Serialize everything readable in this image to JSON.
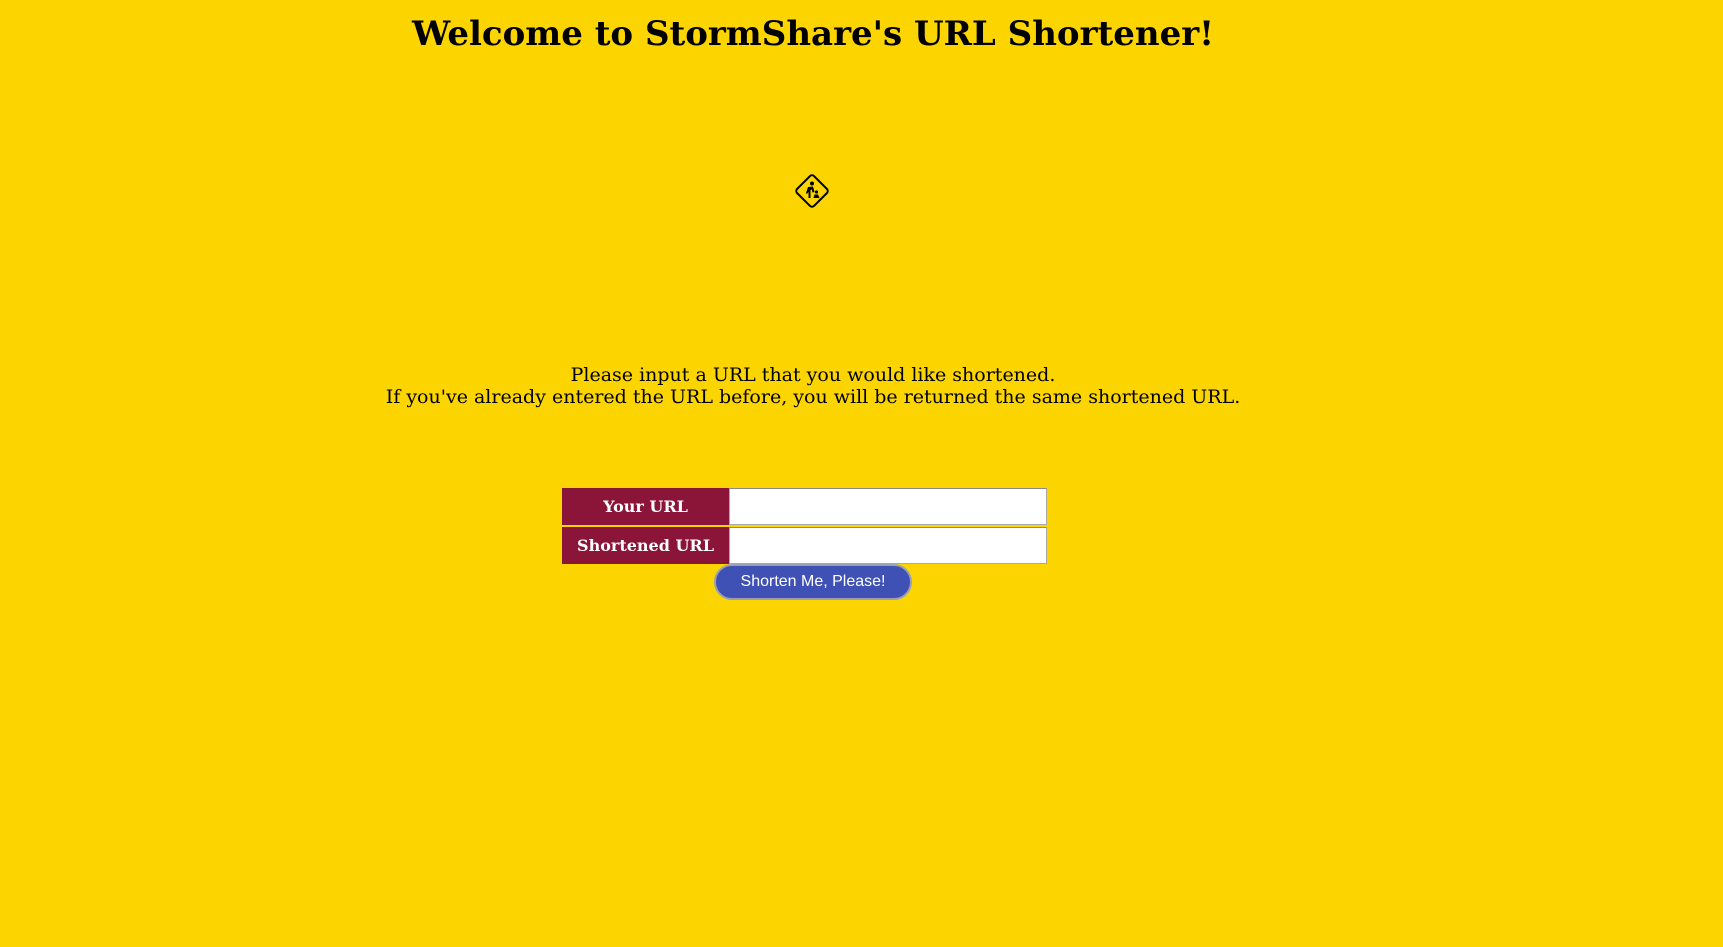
{
  "page": {
    "title": "Welcome to StormShare's URL Shortener!",
    "construction_icon": "construction-sign-icon"
  },
  "intro": {
    "line1": "Please input a URL that you would like shortened.",
    "line2": "If you've already entered the URL before, you will be returned the same shortened URL."
  },
  "form": {
    "your_url_label": "Your URL",
    "your_url_value": "",
    "shortened_url_label": "Shortened URL",
    "shortened_url_value": "",
    "submit_label": "Shorten Me, Please!"
  },
  "colors": {
    "background": "#fcd500",
    "label_bg": "#8b1538",
    "button_bg": "#3f51b5"
  }
}
